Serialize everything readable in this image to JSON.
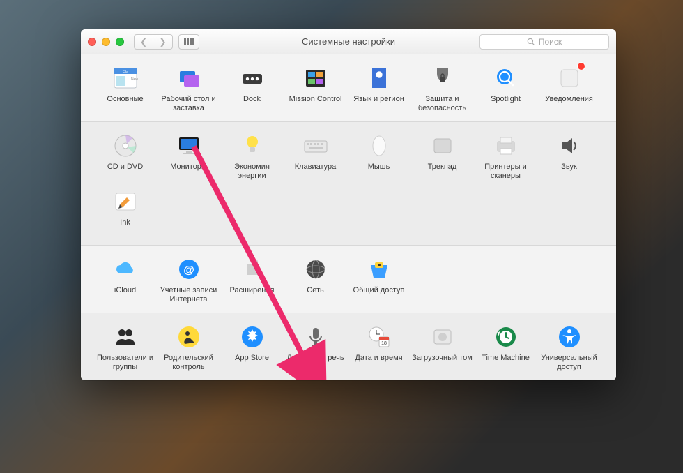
{
  "window": {
    "title": "Системные настройки",
    "search_placeholder": "Поиск"
  },
  "sections": [
    {
      "alt": false,
      "items": [
        {
          "id": "general",
          "label": "Основные"
        },
        {
          "id": "desktop",
          "label": "Рабочий стол и заставка"
        },
        {
          "id": "dock",
          "label": "Dock"
        },
        {
          "id": "mission",
          "label": "Mission Control"
        },
        {
          "id": "language",
          "label": "Язык и регион"
        },
        {
          "id": "security",
          "label": "Защита и безопасность"
        },
        {
          "id": "spotlight",
          "label": "Spotlight"
        },
        {
          "id": "notifications",
          "label": "Уведомления",
          "badge": true
        }
      ]
    },
    {
      "alt": true,
      "items": [
        {
          "id": "cddvd",
          "label": "CD и DVD"
        },
        {
          "id": "displays",
          "label": "Мониторы"
        },
        {
          "id": "energy",
          "label": "Экономия энергии"
        },
        {
          "id": "keyboard",
          "label": "Клавиатура"
        },
        {
          "id": "mouse",
          "label": "Мышь"
        },
        {
          "id": "trackpad",
          "label": "Трекпад"
        },
        {
          "id": "printers",
          "label": "Принтеры и сканеры"
        },
        {
          "id": "sound",
          "label": "Звук"
        }
      ],
      "items2": [
        {
          "id": "ink",
          "label": "Ink"
        }
      ]
    },
    {
      "alt": false,
      "items": [
        {
          "id": "icloud",
          "label": "iCloud"
        },
        {
          "id": "internet",
          "label": "Учетные записи Интернета"
        },
        {
          "id": "extensions",
          "label": "Расширения"
        },
        {
          "id": "network",
          "label": "Сеть"
        },
        {
          "id": "sharing",
          "label": "Общий доступ"
        }
      ]
    },
    {
      "alt": true,
      "items": [
        {
          "id": "users",
          "label": "Пользователи и группы"
        },
        {
          "id": "parental",
          "label": "Родительский контроль"
        },
        {
          "id": "appstore",
          "label": "App Store"
        },
        {
          "id": "dictation",
          "label": "Диктовка и речь"
        },
        {
          "id": "datetime",
          "label": "Дата и время"
        },
        {
          "id": "startup",
          "label": "Загрузочный том"
        },
        {
          "id": "timemachine",
          "label": "Time Machine"
        },
        {
          "id": "accessibility",
          "label": "Универсальный доступ"
        }
      ]
    }
  ],
  "arrow_target": "appstore"
}
